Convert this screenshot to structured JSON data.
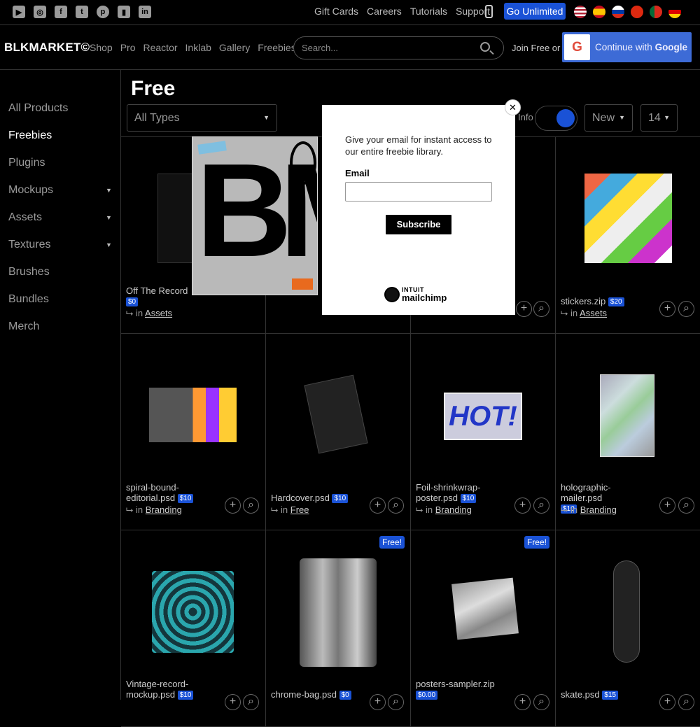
{
  "topbar": {
    "social": [
      "youtube-icon",
      "instagram-icon",
      "facebook-icon",
      "twitter-icon",
      "pinterest-icon",
      "twitch-icon",
      "linkedin-icon"
    ],
    "links": [
      "Gift Cards",
      "Careers",
      "Tutorials",
      "Support"
    ],
    "cta": "Go Unlimited",
    "flags": [
      "us-flag-icon",
      "es-flag-icon",
      "ru-flag-icon",
      "cn-flag-icon",
      "pt-flag-icon",
      "de-flag-icon"
    ]
  },
  "nav": {
    "logo": "BLKMARKET©",
    "links": [
      "Shop",
      "Pro",
      "Reactor",
      "Inklab",
      "Gallery",
      "Freebies"
    ],
    "search_placeholder": "Search...",
    "join": "Join Free or",
    "google_prefix": "Continue with ",
    "google_bold": "Google"
  },
  "sidebar": {
    "items": [
      "All Products",
      "Freebies",
      "Plugins",
      "Mockups",
      "Assets",
      "Textures",
      "Brushes",
      "Bundles",
      "Merch"
    ]
  },
  "page": {
    "title": "Free",
    "type_filter": "All Types",
    "info_label": "Info",
    "sort": "New",
    "count": "14"
  },
  "products": [
    {
      "name": "Off The Record",
      "price": "$0",
      "category": "Assets",
      "free": ""
    },
    {
      "name": "",
      "price": "",
      "category": "",
      "free": ""
    },
    {
      "name": "",
      "price": "",
      "category": "",
      "free": ""
    },
    {
      "name": "stickers.zip",
      "price": "$20",
      "category": "Assets",
      "free": ""
    },
    {
      "name": "spiral-bound-editorial.psd",
      "price": "$10",
      "category": "Branding",
      "free": ""
    },
    {
      "name": "Hardcover.psd",
      "price": "$10",
      "category": "Free",
      "free": ""
    },
    {
      "name": "Foil-shrinkwrap-poster.psd",
      "price": "$10",
      "category": "Branding",
      "free": ""
    },
    {
      "name": "holographic-mailer.psd",
      "price": "$10",
      "category": "Branding",
      "free": ""
    },
    {
      "name": "Vintage-record-mockup.psd",
      "price": "$10",
      "category": "",
      "free": ""
    },
    {
      "name": "chrome-bag.psd",
      "price": "$0",
      "category": "",
      "free": "Free!"
    },
    {
      "name": "posters-sampler.zip",
      "price": "$0.00",
      "category": "",
      "free": "Free!"
    },
    {
      "name": "skate.psd",
      "price": "$15",
      "category": "",
      "free": ""
    }
  ],
  "in_label": "in",
  "popup": {
    "text": "Give your email for instant access to our entire freebie library.",
    "email_label": "Email",
    "button": "Subscribe",
    "brand_top": "INTUIT",
    "brand_bottom": "mailchimp",
    "close": "✕"
  },
  "bag_letters": "BM",
  "colors": {
    "accent": "#1a52d6",
    "bg": "#000000"
  }
}
